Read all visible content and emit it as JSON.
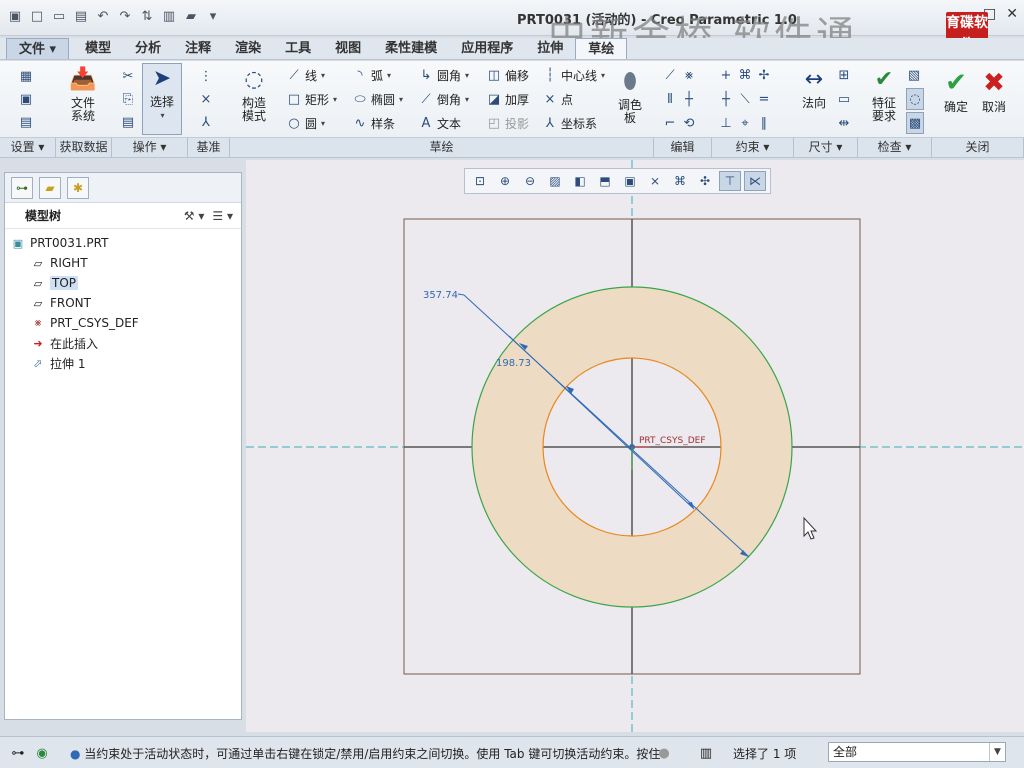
{
  "window": {
    "title": "PRT0031 (活动的) - Creo Parametric 1.0",
    "watermark": "中新金桥 软件通",
    "logo_text": "育碟软件"
  },
  "menu": {
    "file": "文件",
    "tabs": [
      "模型",
      "分析",
      "注释",
      "渲染",
      "工具",
      "视图",
      "柔性建模",
      "应用程序",
      "拉伸",
      "草绘"
    ]
  },
  "ribbon": {
    "settings_group": "设置",
    "getdata_group": "获取数据",
    "file_system": "文件\n系统",
    "operations_group": "操作",
    "select": "选择",
    "datum_group": "基准",
    "construction_mode": "构造\n模式",
    "sketch_group": "草绘",
    "sketch_tools": {
      "line": "线",
      "rect": "矩形",
      "circle": "圆",
      "arc": "弧",
      "ellipse": "椭圆",
      "spline": "样条",
      "fillet": "圆角",
      "chamfer": "倒角",
      "text": "文本",
      "offset": "偏移",
      "thicken": "加厚",
      "project": "投影",
      "centerline": "中心线",
      "point": "点",
      "csys": "坐标系"
    },
    "palette": "调色\n板",
    "edit_group": "编辑",
    "constraint_group": "约束",
    "normal": "法向",
    "dimension_group": "尺寸",
    "feature_req": "特征\n要求",
    "inspect_group": "检查",
    "ok": "确定",
    "cancel": "取消",
    "close_group": "关闭"
  },
  "model_tree": {
    "header": "模型树",
    "items": [
      {
        "label": "PRT0031.PRT",
        "icon": "part-icon"
      },
      {
        "label": "RIGHT",
        "icon": "datum-plane-icon"
      },
      {
        "label": "TOP",
        "icon": "datum-plane-icon"
      },
      {
        "label": "FRONT",
        "icon": "datum-plane-icon"
      },
      {
        "label": "PRT_CSYS_DEF",
        "icon": "csys-icon"
      },
      {
        "label": "在此插入",
        "icon": "insert-arrow-icon"
      },
      {
        "label": "拉伸 1",
        "icon": "extrude-icon"
      }
    ]
  },
  "sketch": {
    "outer_dim": "357.74",
    "inner_dim": "198.73",
    "csys_label": "PRT_CSYS_DEF",
    "fill_color": "#eddcc3",
    "outer_color": "#3aa548",
    "inner_color": "#e8881c",
    "dim_color": "#2f6bb5"
  },
  "status": {
    "message": "当约束处于活动状态时，可通过单击右键在锁定/禁用/启用约束之间切换。使用 Tab 键可切换活动约束。按住",
    "selected": "选择了 1 项",
    "filter": "全部"
  }
}
